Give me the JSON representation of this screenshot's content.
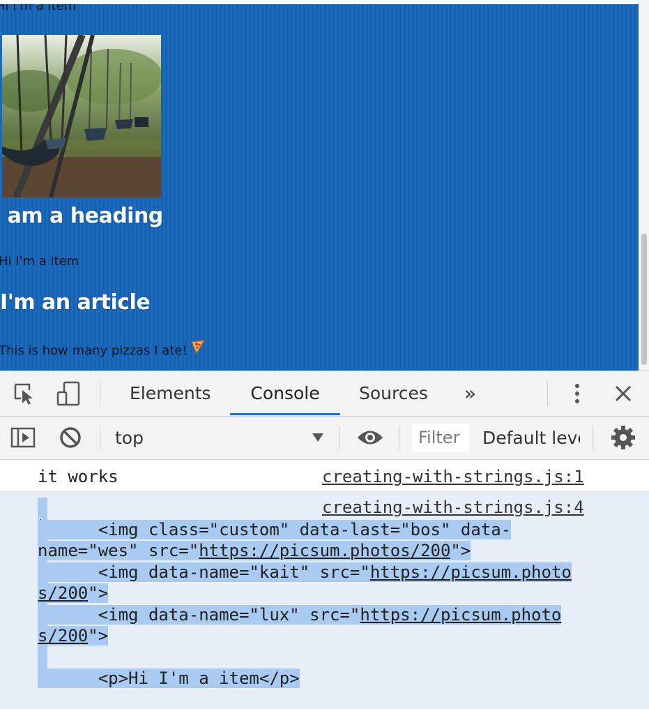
{
  "page": {
    "top_item_text": "Hi I'm a item",
    "heading1": "I am a heading",
    "item_text": "Hi I'm a item",
    "heading2": "I'm an article",
    "pizza_text": "This is how many pizzas I ate!",
    "background_color": "#1565b9",
    "photo_subject": "playground swings"
  },
  "devtools": {
    "tabs": [
      {
        "label": "Elements"
      },
      {
        "label": "Console",
        "active": true
      },
      {
        "label": "Sources"
      }
    ],
    "more_tabs_label": "»",
    "icons": {
      "inspect": "inspect-element-icon",
      "device": "device-toolbar-icon",
      "kebab": "more-options-icon",
      "close": "close-icon",
      "sidebar": "console-sidebar-icon",
      "clear": "clear-console-icon",
      "eye": "live-expression-icon",
      "settings": "gear-icon"
    },
    "accent_color": "#1a73e8"
  },
  "toolbar": {
    "context": "top",
    "filter_placeholder": "Filter",
    "levels_label": "Default leve"
  },
  "console": {
    "messages": [
      {
        "text": "it works",
        "source": "creating-with-strings.js:1"
      },
      {
        "source": "creating-with-strings.js:4",
        "lines": [
          {
            "pre": "      <img class=\"custom\" data-last=\"bos\" data-"
          },
          {
            "pre": "name=\"wes\" src=\"",
            "link": "https://picsum.photos/200",
            "post": "\">"
          },
          {
            "pre": "      <img data-name=\"kait\" src=\"",
            "link": "https://picsum.photo"
          },
          {
            "link": "s/200",
            "post": "\">"
          },
          {
            "pre": "      <img data-name=\"lux\" src=\"",
            "link": "https://picsum.photo"
          },
          {
            "link": "s/200",
            "post": "\">"
          },
          {
            "pre": ""
          },
          {
            "pre": "      <p>Hi I'm a item</p>"
          }
        ]
      }
    ],
    "selection_color": "#a9cbf2"
  }
}
